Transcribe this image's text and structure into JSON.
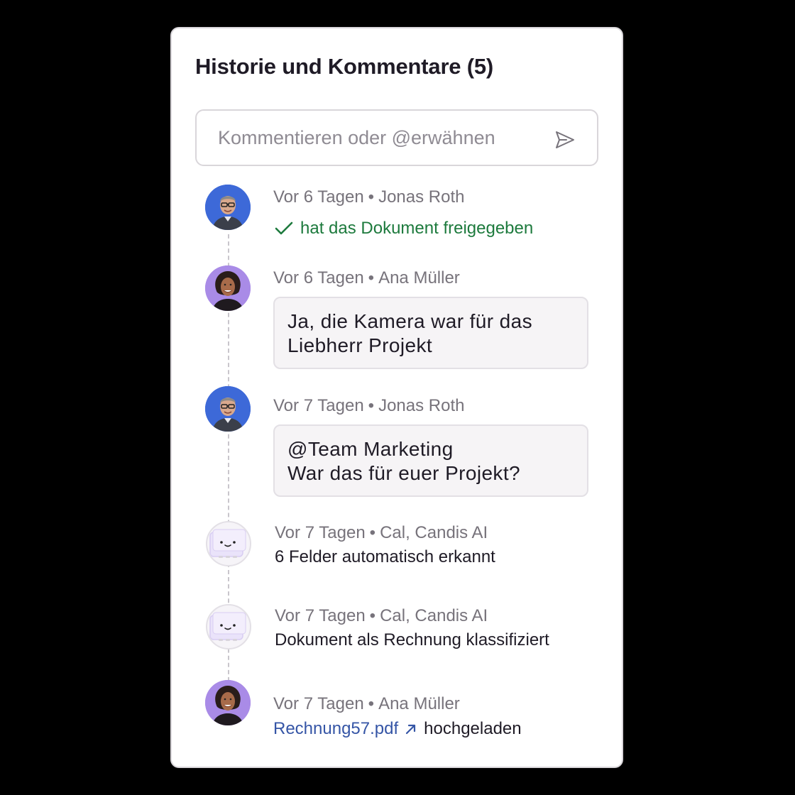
{
  "panel": {
    "title": "Historie und Kommentare (5)"
  },
  "comment_box": {
    "placeholder": "Kommentieren oder @erwähnen",
    "send_icon": "send-icon"
  },
  "entries": [
    {
      "time": "Vor 6 Tagen",
      "author": "Jonas Roth",
      "action": "hat das Dokument freigegeben",
      "icon": "check-icon",
      "avatar": "avatar-jonas"
    },
    {
      "time": "Vor 6 Tagen",
      "author": "Ana Müller",
      "comment_lines": [
        "Ja, die Kamera war für das",
        "Liebherr Projekt"
      ],
      "avatar": "avatar-ana"
    },
    {
      "time": "Vor 7 Tagen",
      "author": "Jonas Roth",
      "comment_lines": [
        "@Team Marketing",
        "War das für euer Projekt?"
      ],
      "avatar": "avatar-jonas"
    },
    {
      "time": "Vor 7 Tagen",
      "author": "Cal, Candis AI",
      "text": "6 Felder automatisch erkannt",
      "avatar": "bot-avatar"
    },
    {
      "time": "Vor 7 Tagen",
      "author": "Cal, Candis AI",
      "text": "Dokument als Rechnung klassifiziert",
      "avatar": "bot-avatar"
    },
    {
      "time": "Vor 7 Tagen",
      "author": "Ana Müller",
      "file": "Rechnung57.pdf",
      "file_icon": "external-link-icon",
      "suffix": "hochgeladen",
      "avatar": "avatar-ana"
    }
  ],
  "separator": "•",
  "colors": {
    "approved_green": "#1d7a3d",
    "link_blue": "#3555a6",
    "muted_text": "#77737b",
    "avatar_blue": "#3d69d8",
    "avatar_purple": "#a98be7"
  }
}
